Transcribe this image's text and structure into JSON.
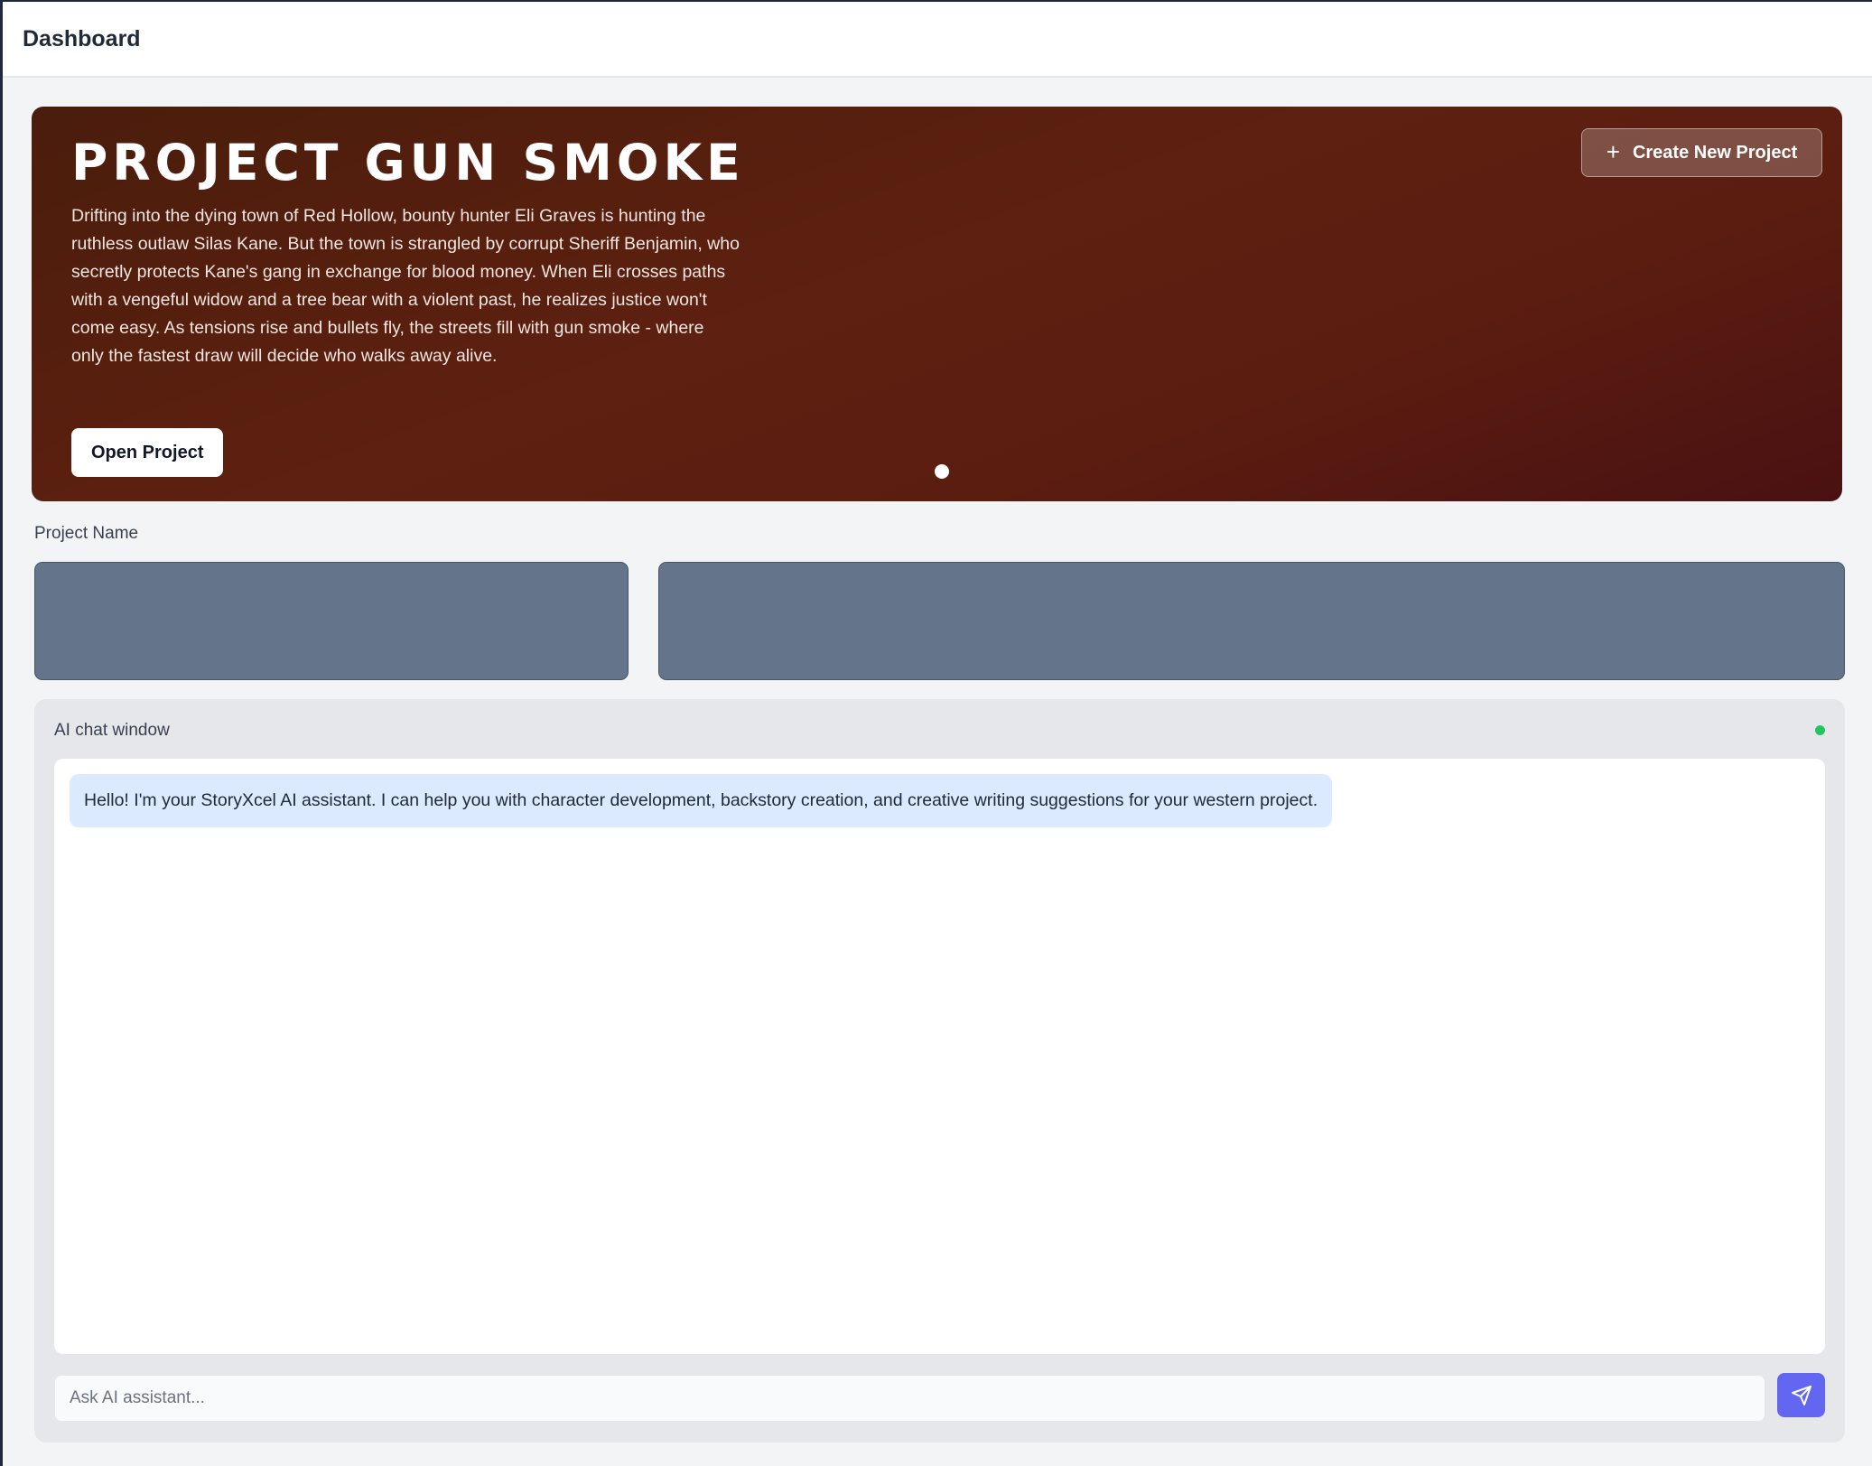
{
  "header": {
    "title": "Dashboard"
  },
  "hero": {
    "title": "PROJECT GUN SMOKE",
    "description": "Drifting into the dying town of Red Hollow, bounty hunter Eli Graves is hunting the ruthless outlaw Silas Kane. But the town is strangled by corrupt Sheriff Benjamin, who secretly protects Kane's gang in exchange for blood money. When Eli crosses paths with a vengeful widow and a tree bear with a violent past, he realizes justice won't come easy. As tensions rise and bullets fly, the streets fill with gun smoke - where only the fastest draw will decide who walks away alive.",
    "open_button": "Open Project",
    "create_button": "Create New Project",
    "create_icon": "plus-icon",
    "carousel": {
      "slides": 1,
      "active": 1
    }
  },
  "project_section": {
    "label": "Project Name"
  },
  "chat": {
    "title": "AI chat window",
    "status": "online",
    "status_color": "#22c55e",
    "messages": [
      {
        "role": "assistant",
        "text": "Hello! I'm your StoryXcel AI assistant. I can help you with character development, backstory creation, and creative writing suggestions for your western project."
      }
    ],
    "input_value": "",
    "input_placeholder": "Ask AI assistant...",
    "send_icon": "send-icon"
  },
  "colors": {
    "accent": "#6366f1",
    "hero_bg": "#5e2010",
    "card_bg": "#64748b",
    "bubble_bg": "#dbeafe"
  }
}
